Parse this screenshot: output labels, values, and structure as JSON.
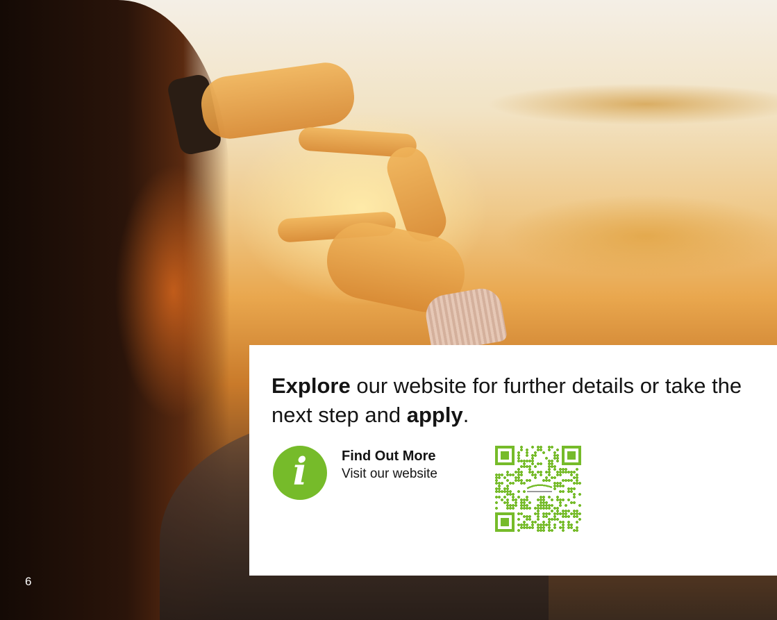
{
  "page": {
    "number": "6"
  },
  "card": {
    "headline": {
      "part1_bold": "Explore",
      "part2": " our website for further details or take the next step and ",
      "part3_bold": "apply",
      "part4": "."
    },
    "cta": {
      "title": "Find Out More",
      "subtitle": "Visit our website",
      "icon": "info-icon"
    }
  },
  "colors": {
    "accent_green": "#76bb2a",
    "card_bg": "#ffffff",
    "text": "#141414"
  }
}
